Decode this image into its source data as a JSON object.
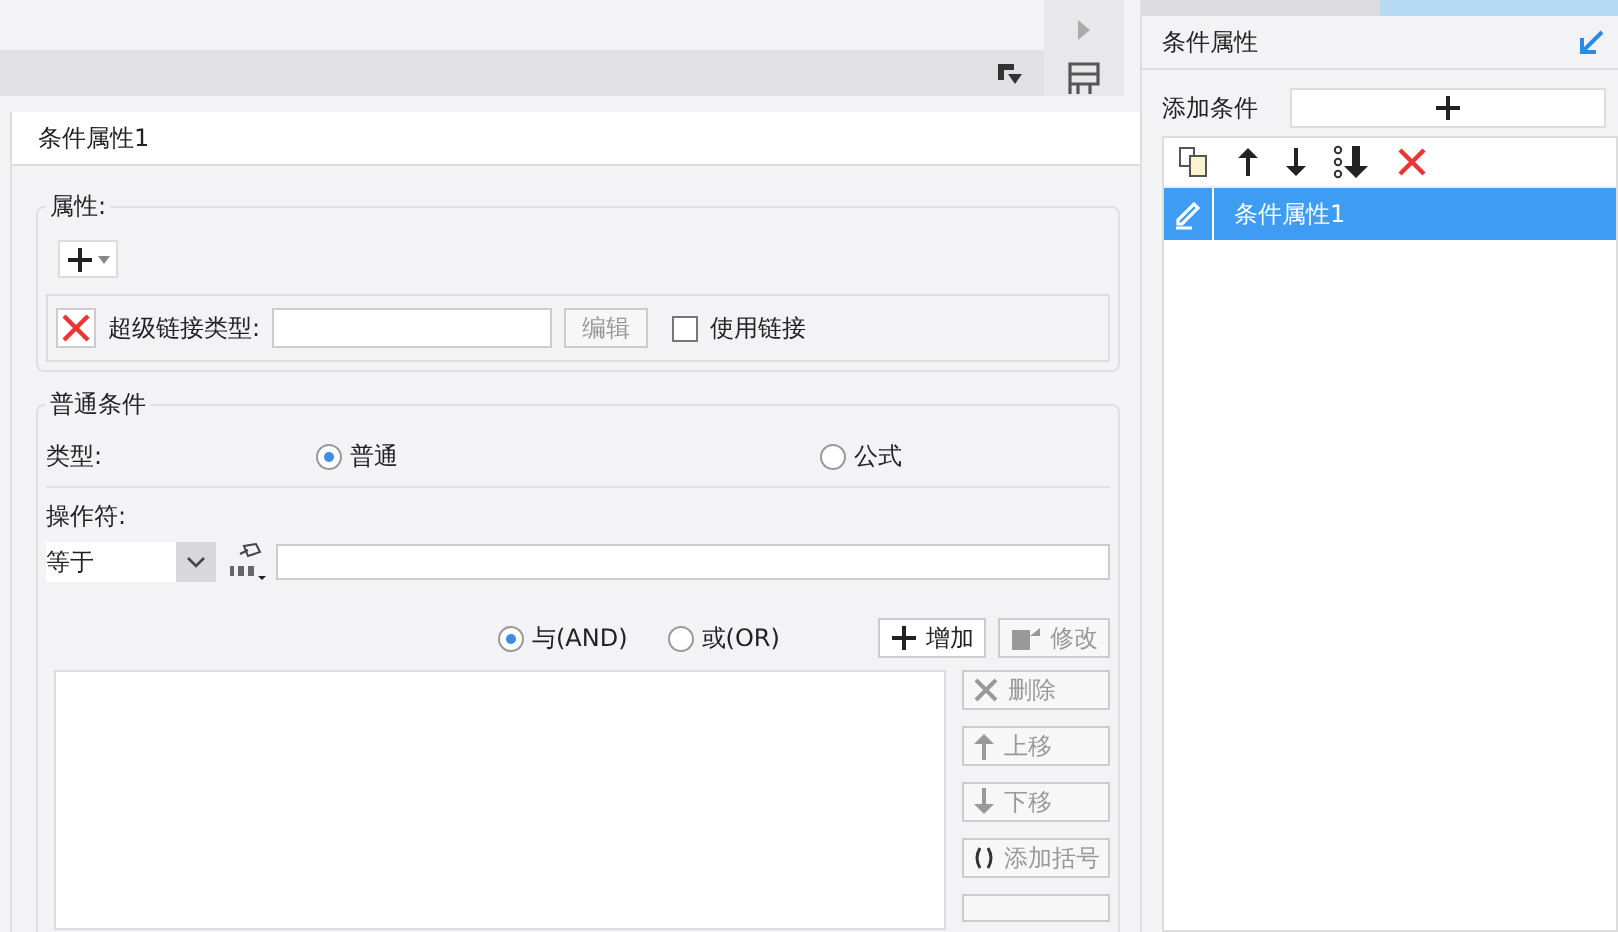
{
  "dialog": {
    "title": "条件属性1",
    "attributes": {
      "legend": "属性:",
      "hyperlink_label": "超级链接类型:",
      "edit_button": {
        "label": "编辑",
        "disabled": true
      },
      "use_link": {
        "label": "使用链接",
        "checked": false
      }
    },
    "normal_condition": {
      "legend": "普通条件",
      "type_label": "类型:",
      "type_options": [
        {
          "label": "普通",
          "selected": true
        },
        {
          "label": "公式",
          "selected": false
        }
      ],
      "operator_label": "操作符:",
      "operator": "等于",
      "logic_options": [
        {
          "label": "与(AND)",
          "selected": true
        },
        {
          "label": "或(OR)",
          "selected": false
        }
      ],
      "buttons": [
        {
          "kind": "add",
          "label": "增加",
          "disabled": false
        },
        {
          "kind": "edit",
          "label": "修改",
          "disabled": true
        }
      ],
      "side_buttons": [
        {
          "kind": "delete",
          "label": "删除",
          "disabled": true
        },
        {
          "kind": "up",
          "label": "上移",
          "disabled": true
        },
        {
          "kind": "down",
          "label": "下移",
          "disabled": true
        },
        {
          "kind": "bracket",
          "label": "添加括号",
          "disabled": true
        }
      ]
    }
  },
  "side_panel": {
    "title": "条件属性",
    "add_label": "添加条件",
    "conditions": [
      {
        "label": "条件属性1",
        "selected": true
      }
    ]
  }
}
